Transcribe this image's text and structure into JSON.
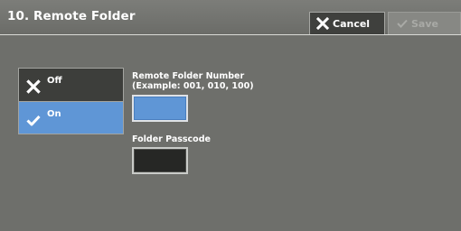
{
  "header": {
    "title": "10. Remote Folder",
    "cancel_label": "Cancel",
    "save_label": "Save"
  },
  "options": [
    {
      "label": "Off",
      "icon": "x-icon",
      "selected": false
    },
    {
      "label": "On",
      "icon": "checkmark-icon",
      "selected": true
    }
  ],
  "fields": {
    "remote_folder_number": {
      "label_line1": "Remote Folder Number",
      "label_line2": "(Example: 001, 010, 100)",
      "value": ""
    },
    "folder_passcode": {
      "label": "Folder Passcode",
      "value": ""
    }
  },
  "colors": {
    "background": "#6e6f6b",
    "selected": "#5f96d6",
    "dark_button": "#3d3e3b",
    "passcode_box": "#262725"
  }
}
